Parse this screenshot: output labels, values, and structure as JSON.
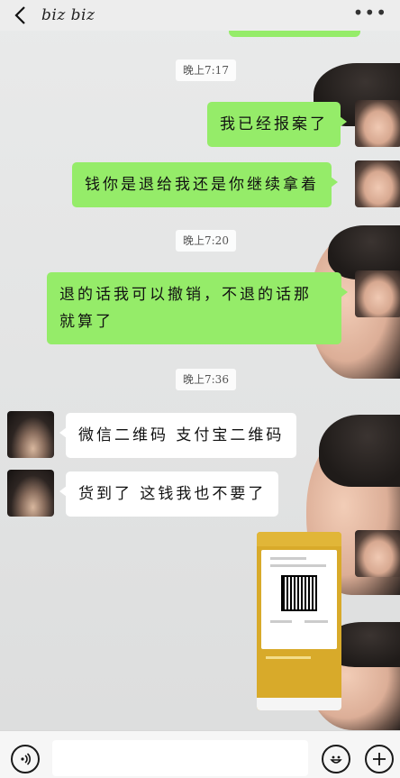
{
  "header": {
    "title": "biz biz",
    "back_icon": "chevron-left-icon",
    "more_icon": "more-dots-icon",
    "more_glyph": "•••"
  },
  "timestamps": [
    "晚上7:17",
    "晚上7:20",
    "晚上7:36"
  ],
  "messages": [
    {
      "direction": "out",
      "text": "我已经报案了"
    },
    {
      "direction": "out",
      "text": "钱你是退给我还是你继续拿着"
    },
    {
      "direction": "out",
      "text": "退的话我可以撤销，不退的话那就算了"
    },
    {
      "direction": "in",
      "text": "微信二维码 支付宝二维码"
    },
    {
      "direction": "in",
      "text": "货到了 这钱我也不要了"
    },
    {
      "direction": "out",
      "type": "image",
      "description_icon": "qr-code-screenshot-icon"
    }
  ],
  "input_bar": {
    "voice_icon": "voice-icon",
    "emoji_icon": "emoji-icon",
    "plus_icon": "plus-icon",
    "input_value": ""
  },
  "colors": {
    "outgoing_bubble": "#95ec69",
    "incoming_bubble": "#ffffff",
    "timestamp_bg": "#ffffff",
    "header_bg": "#ededed"
  }
}
